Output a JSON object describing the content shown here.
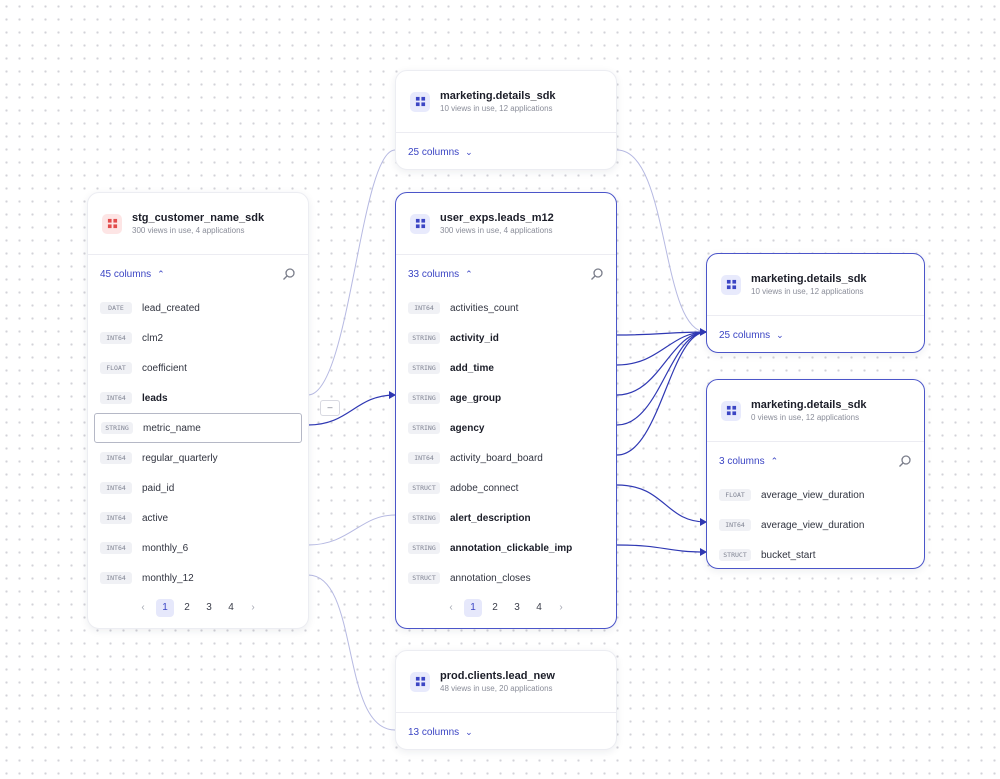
{
  "colors": {
    "accent": "#3b45c4",
    "edge": "#2f38b3",
    "edge_faint": "#b6b9e2",
    "red_icon": "#e24b4b"
  },
  "icons": {
    "table": "table-icon",
    "search": "search-icon",
    "chevron": "chevron-icon"
  },
  "cards": {
    "top": {
      "name": "marketing.details_sdk",
      "meta": "10 views in use, 12 applications",
      "columns": "25 columns"
    },
    "left": {
      "name": "stg_customer_name_sdk",
      "meta": "300 views in use, 4 applications",
      "columns": "45 columns",
      "rows": [
        {
          "type": "DATE",
          "name": "lead_created"
        },
        {
          "type": "INT64",
          "name": "clm2"
        },
        {
          "type": "FLOAT",
          "name": "coefficient"
        },
        {
          "type": "INT64",
          "name": "leads"
        },
        {
          "type": "STRING",
          "name": "metric_name"
        },
        {
          "type": "INT64",
          "name": "regular_quarterly"
        },
        {
          "type": "INT64",
          "name": "paid_id"
        },
        {
          "type": "INT64",
          "name": "active"
        },
        {
          "type": "INT64",
          "name": "monthly_6"
        },
        {
          "type": "INT64",
          "name": "monthly_12"
        }
      ],
      "pages": [
        "1",
        "2",
        "3",
        "4"
      ]
    },
    "middle": {
      "name": "user_exps.leads_m12",
      "meta": "300 views in use, 4 applications",
      "columns": "33 columns",
      "rows": [
        {
          "type": "INT64",
          "name": "activities_count"
        },
        {
          "type": "STRING",
          "name": "activity_id"
        },
        {
          "type": "STRING",
          "name": "add_time"
        },
        {
          "type": "STRING",
          "name": "age_group"
        },
        {
          "type": "STRING",
          "name": "agency"
        },
        {
          "type": "INT64",
          "name": "activity_board_board"
        },
        {
          "type": "STRUCT",
          "name": "adobe_connect"
        },
        {
          "type": "STRING",
          "name": "alert_description"
        },
        {
          "type": "STRING",
          "name": "annotation_clickable_imp"
        },
        {
          "type": "STRUCT",
          "name": "annotation_closes"
        }
      ],
      "pages": [
        "1",
        "2",
        "3",
        "4"
      ]
    },
    "bottom": {
      "name": "prod.clients.lead_new",
      "meta": "48 views in use, 20 applications",
      "columns": "13 columns"
    },
    "right_top": {
      "name": "marketing.details_sdk",
      "meta": "10 views in use, 12 applications",
      "columns": "25 columns"
    },
    "right_bottom": {
      "name": "marketing.details_sdk",
      "meta": "0 views in use, 12 applications",
      "columns": "3 columns",
      "rows": [
        {
          "type": "FLOAT",
          "name": "average_view_duration"
        },
        {
          "type": "INT64",
          "name": "average_view_duration"
        },
        {
          "type": "STRUCT",
          "name": "bucket_start"
        }
      ]
    }
  },
  "nav": {
    "prev": "‹",
    "next": "›",
    "chevron_up": "⌃",
    "chevron_down": "⌄",
    "collapse": "–"
  }
}
